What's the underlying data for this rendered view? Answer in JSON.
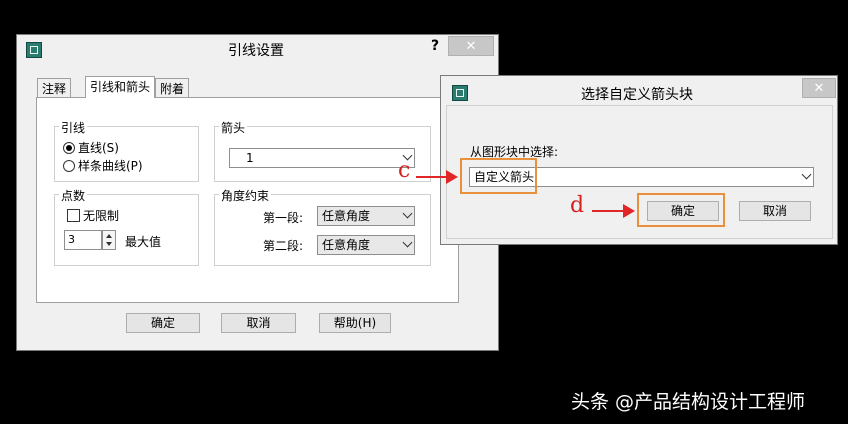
{
  "main_dialog": {
    "title": "引线设置",
    "help": "?",
    "close": "✕",
    "tabs": [
      "注释",
      "引线和箭头",
      "附着"
    ],
    "leader_group": {
      "label": "引线",
      "options": [
        "直线(S)",
        "样条曲线(P)"
      ],
      "selected": 0
    },
    "arrow_group": {
      "label": "箭头",
      "value": "1"
    },
    "points_group": {
      "label": "点数",
      "unlimited_label": "无限制",
      "count": "3",
      "max_label": "最大值"
    },
    "angle_group": {
      "label": "角度约束",
      "first_label": "第一段:",
      "first_value": "任意角度",
      "second_label": "第二段:",
      "second_value": "任意角度"
    },
    "buttons": {
      "ok": "确定",
      "cancel": "取消",
      "help": "帮助(H)"
    }
  },
  "block_dialog": {
    "title": "选择自定义箭头块",
    "close": "✕",
    "select_label": "从图形块中选择:",
    "select_value": "自定义箭头",
    "buttons": {
      "ok": "确定",
      "cancel": "取消"
    }
  },
  "annotations": {
    "c": "c",
    "d": "d"
  },
  "watermark": "头条 @产品结构设计工程师",
  "colors": {
    "highlight": "#e8903c",
    "annotation": "#d42020"
  }
}
